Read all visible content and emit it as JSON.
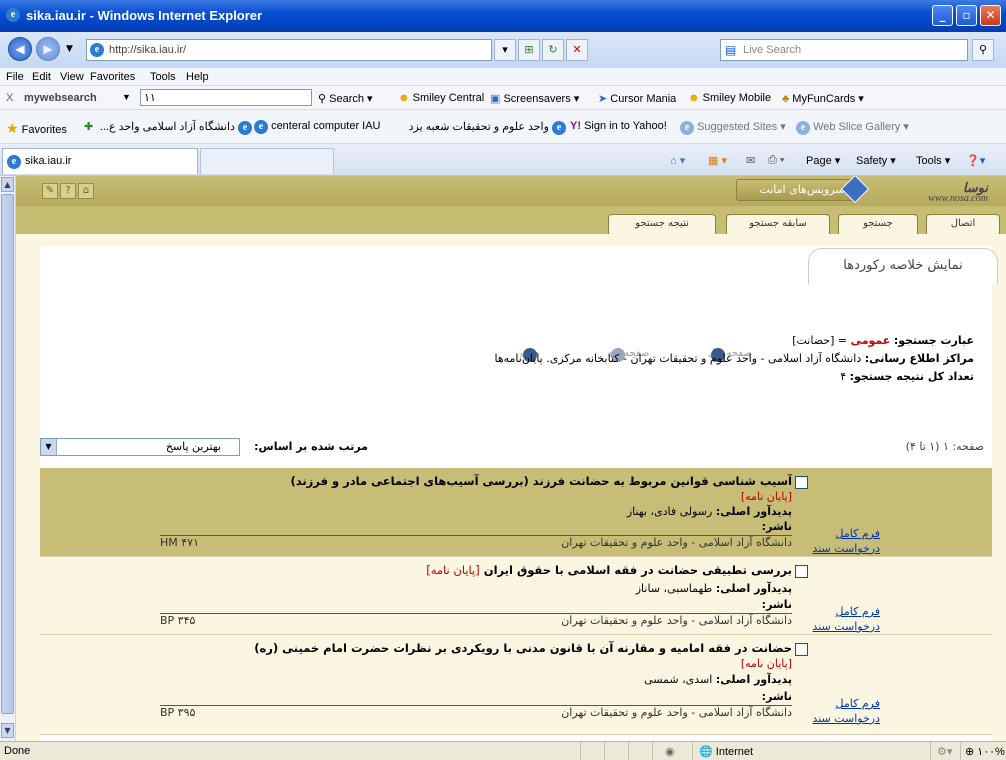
{
  "window": {
    "title": "sika.iau.ir - Windows Internet Explorer"
  },
  "address": {
    "url": "http://sika.iau.ir/",
    "search_placeholder": "Live Search"
  },
  "menu": [
    "File",
    "Edit",
    "View",
    "Favorites",
    "Tools",
    "Help"
  ],
  "mws_toolbar": {
    "close": "X",
    "brand": "mywebsearch",
    "query": "١١",
    "search": "Search",
    "items": [
      "Smiley Central",
      "Screensavers",
      "Cursor Mania",
      "Smiley Mobile",
      "MyFunCards"
    ]
  },
  "favorites_bar": {
    "label": "Favorites",
    "items": [
      "دانشگاه آزاد اسلامی واحد ع...",
      "centeral computer IAU",
      "واحد علوم و تحقیقات شعبه یزد",
      "Sign in to Yahoo!",
      "Suggested Sites",
      "Web Slice Gallery"
    ]
  },
  "tab": {
    "label": "sika.iau.ir"
  },
  "commandbar": {
    "page": "Page",
    "safety": "Safety",
    "tools": "Tools"
  },
  "site": {
    "logo_main": "نوسا",
    "logo_sub": "www.nosa.com",
    "services_button": "سرویس‌های امانت",
    "nav_tabs": [
      "اتصال",
      "جستجو",
      "سابقه جستجو",
      "نتیجه جستجو"
    ],
    "summary_tab": "نمایش خلاصه رکوردها",
    "prev_page": "صفحه قبل",
    "next_page": "صفحه بعد",
    "print": "چاپ"
  },
  "query_info": {
    "expr_label": "عبارت جستجو:",
    "expr_field": "عمومی",
    "expr_value": "= [حضانت]",
    "centers_label": "مراکز اطلاع رسانی:",
    "centers_value": "دانشگاه آزاد اسلامی - واحد علوم و تحقیقات تهران - کتابخانه مرکزی. پایان‌نامه‌ها",
    "total_label": "تعداد کل نتیجه جستجو:",
    "total_value": "۴"
  },
  "sort": {
    "label": "مرتب شده بر اساس:",
    "selected": "بهترین پاسخ",
    "page_info": "صفحه: ۱ (۱ تا ۴)"
  },
  "records": [
    {
      "title": "آسیب شناسی قوانین مربوط به حضانت فرزند (بررسی آسیب‌های اجتماعی مادر و فرزند)",
      "type": "[پایان نامه]",
      "author_label": "پدیدآور اصلی:",
      "author": "رسولی فادی، بهناز",
      "publisher_label": "ناشر:",
      "org": "دانشگاه آزاد اسلامی - واحد علوم و تحقیقات تهران",
      "call": "HM ۴۷۱",
      "full_form": "فرم کامل",
      "request": "درخواست سند"
    },
    {
      "title": "بررسی تطبیقی حضانت در فقه اسلامی با حقوق ایران",
      "type": "[پایان نامه]",
      "author_label": "پدیدآور اصلی:",
      "author": "طهماسبی، ساناز",
      "publisher_label": "ناشر:",
      "org": "دانشگاه آزاد اسلامی - واحد علوم و تحقیقات تهران",
      "call": "BP ۳۴۵",
      "full_form": "فرم کامل",
      "request": "درخواست سند"
    },
    {
      "title": "حضانت در فقه امامیه و مقارنه آن با قانون مدنی با رویکردی بر نظرات حضرت امام خمینی (ره)",
      "type": "[پایان نامه]",
      "author_label": "پدیدآور اصلی:",
      "author": "اسدی، شمسی",
      "publisher_label": "ناشر:",
      "org": "دانشگاه آزاد اسلامی - واحد علوم و تحقیقات تهران",
      "call": "BP ۳۹۵",
      "full_form": "فرم کامل",
      "request": "درخواست سند"
    }
  ],
  "status": {
    "left": "Done",
    "zone": "Internet",
    "zoom": "۱۰۰%"
  },
  "colors": {
    "titlebar": "#0a4fd0",
    "site_header": "#c6bc72",
    "highlight_row": "#c8bd76",
    "accent_red": "#c00000",
    "link": "#0033aa"
  }
}
